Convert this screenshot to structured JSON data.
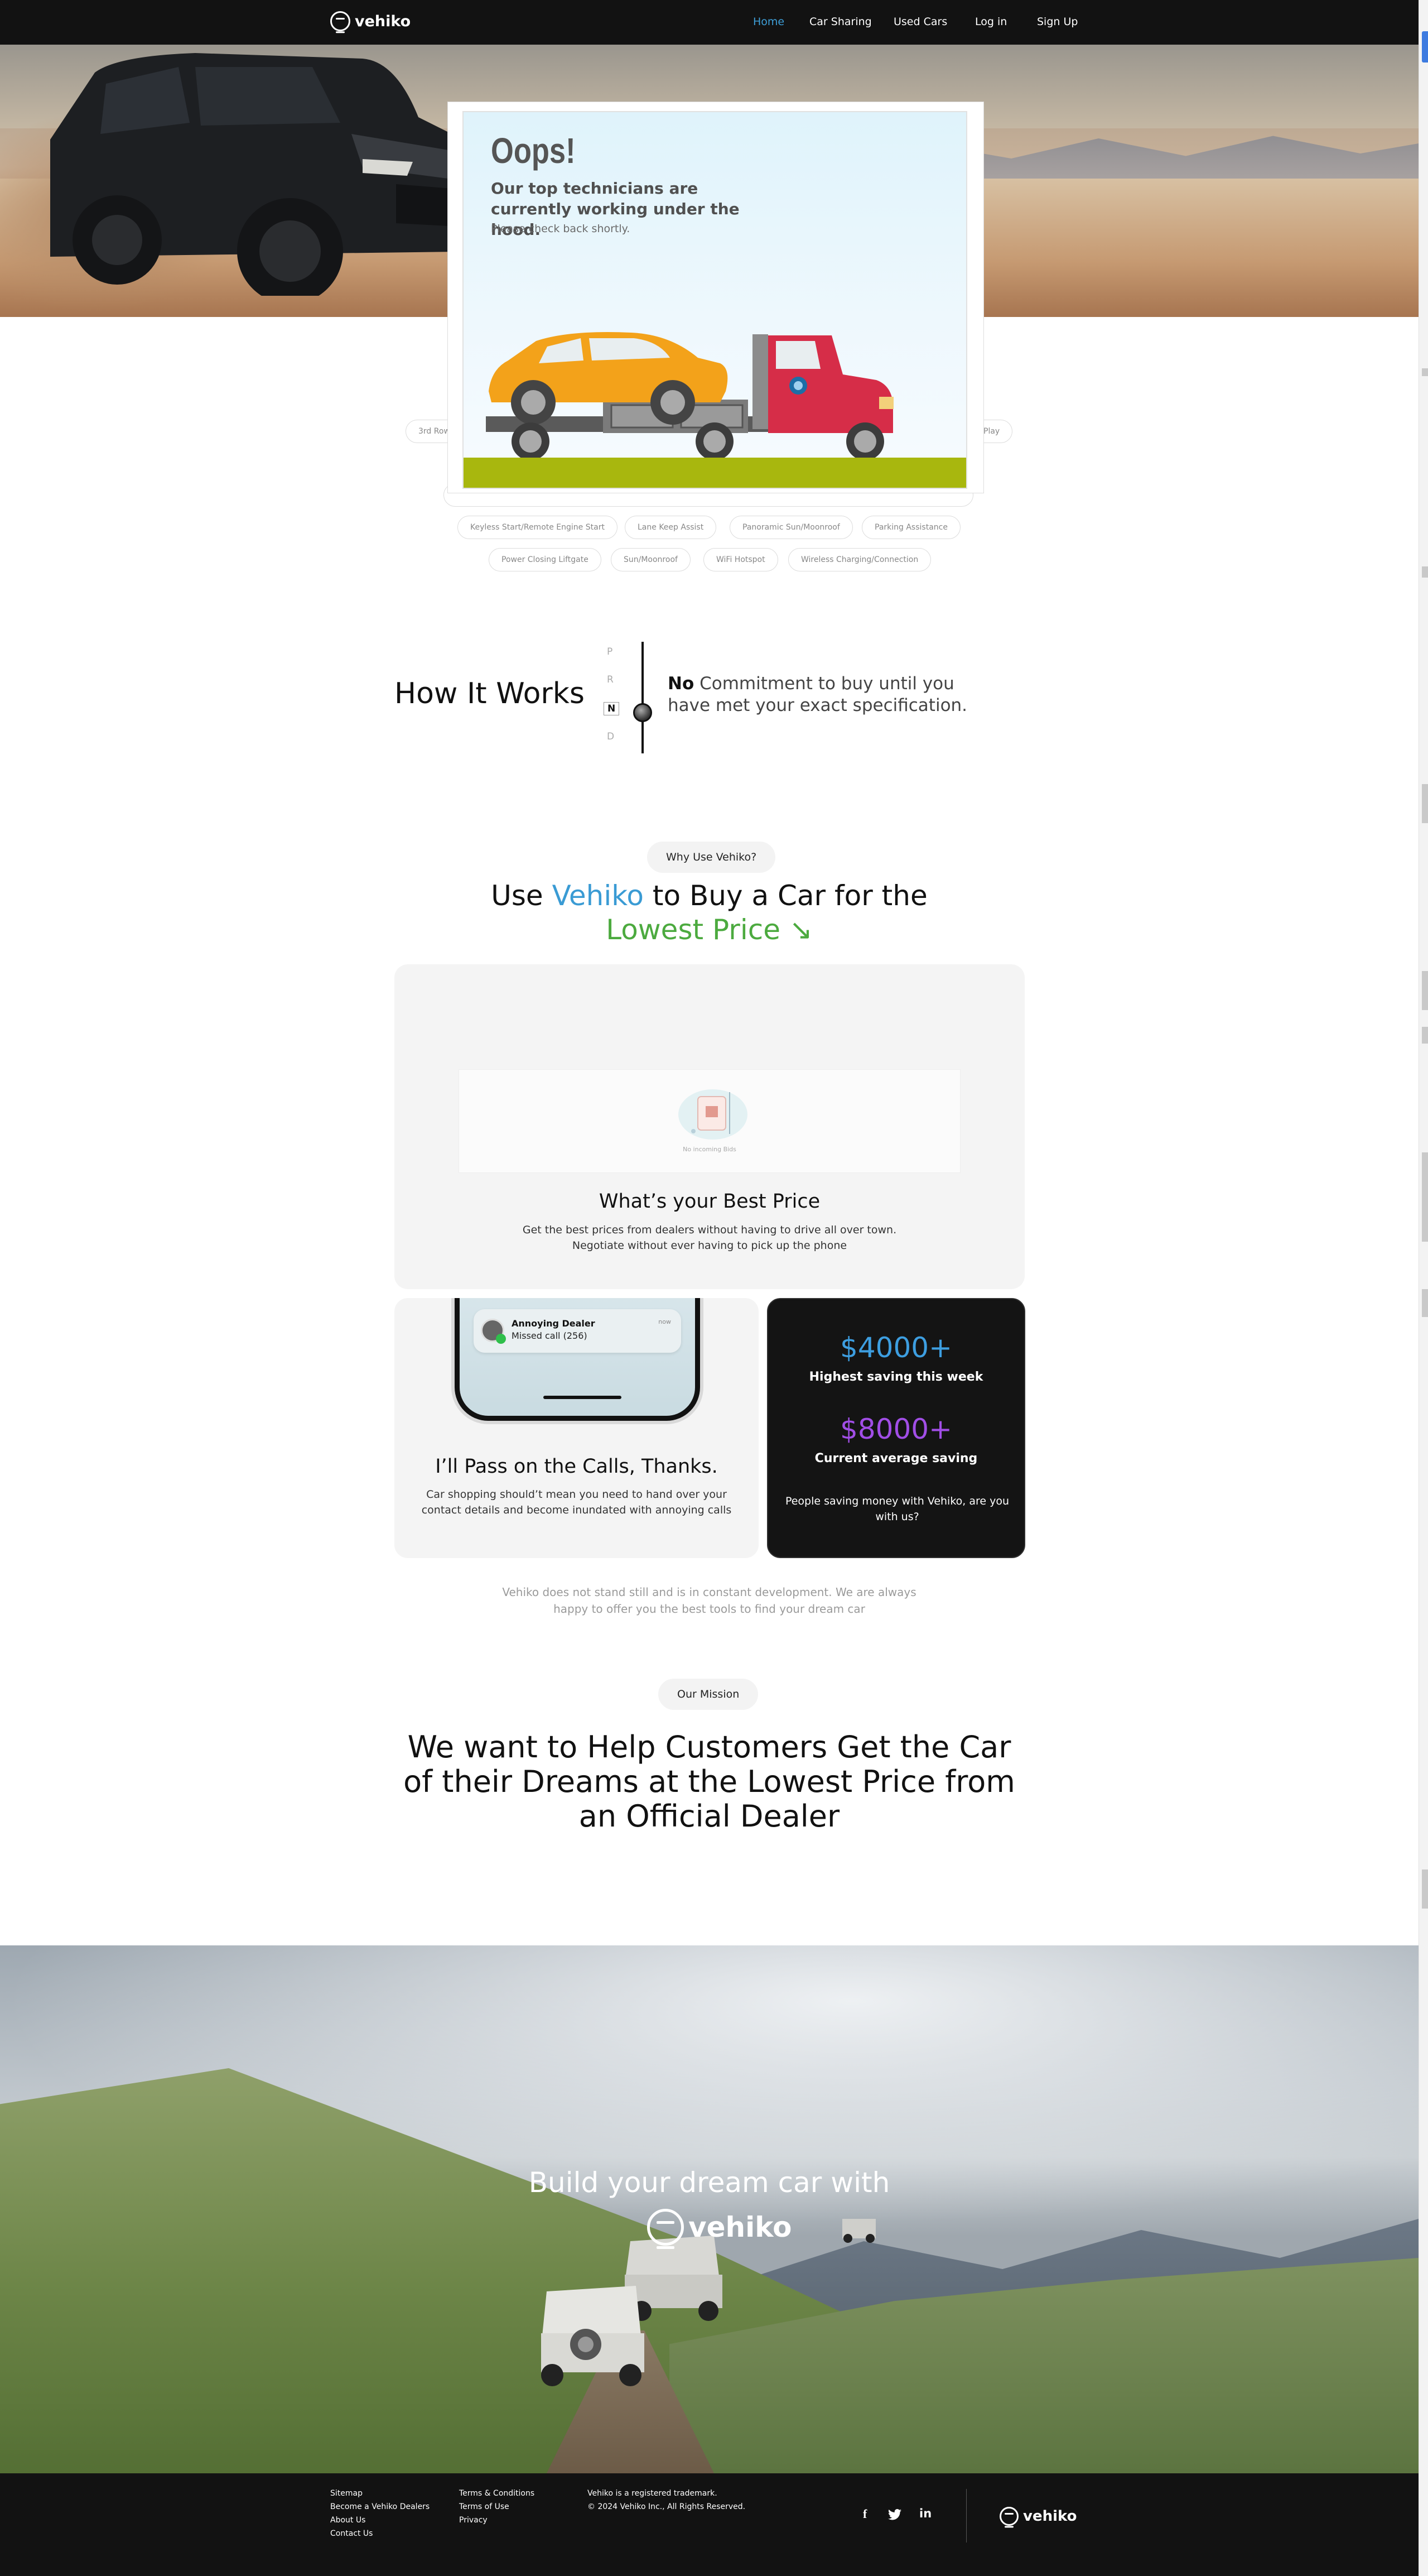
{
  "nav": {
    "brand": "vehiko",
    "items": [
      {
        "label": "Home",
        "active": true
      },
      {
        "label": "Car Sharing"
      },
      {
        "label": "Used Cars"
      },
      {
        "label": "Log in"
      },
      {
        "label": "Sign Up"
      }
    ]
  },
  "modal": {
    "title": "Oops!",
    "subtitle": "Our top technicians are currently working under the hood.",
    "note": "Please check back shortly."
  },
  "features": {
    "chips": [
      "3rd Row",
      "Play",
      "Keyless Start/Remote Engine Start",
      "Lane Keep Assist",
      "Panoramic Sun/Moonroof",
      "Parking Assistance",
      "Power Closing Liftgate",
      "Sun/Moonroof",
      "WiFi Hotspot",
      "Wireless Charging/Connection"
    ]
  },
  "how_it_works": {
    "title": "How It Works",
    "gears": [
      "P",
      "R",
      "N",
      "D"
    ],
    "selected_gear": "N",
    "highlight": "No",
    "text": " Commitment to buy until you have met your exact specification."
  },
  "why": {
    "pill": "Why Use Vehiko?",
    "heading_pre": "Use ",
    "heading_brand": "Vehiko",
    "heading_mid": " to Buy a Car for the",
    "heading_green": "Lowest Price ↘",
    "colors": {
      "brand": "#3a9bd4",
      "green": "#4caa3f"
    }
  },
  "card_best_price": {
    "empty_text": "No incoming Bids",
    "title": "What’s your Best Price",
    "text_line1": "Get the best prices from dealers without having to drive all over town.",
    "text_line2": "Negotiate without ever having to pick up the phone"
  },
  "card_calls": {
    "notif_title": "Annoying Dealer",
    "notif_body": "Missed call (256)",
    "notif_time": "now",
    "title": "I’ll Pass on the Calls, Thanks.",
    "text": "Car shopping should’t mean you need to hand over your contact details and become inundated with annoying calls"
  },
  "card_stats": {
    "stat1_value": "$4000+",
    "stat1_label": "Highest saving this week",
    "stat2_value": "$8000+",
    "stat2_label": "Current average saving",
    "note": "People saving money with Vehiko, are you with us?",
    "colors": {
      "stat1": "#3d9ee0",
      "stat2": "#a14ee6"
    }
  },
  "footnote": "Vehiko does not stand still and is in constant development. We are always happy to offer you the best tools to find your dream car",
  "mission": {
    "pill": "Our Mission",
    "heading": "We want to Help Customers Get the Car of their Dreams at the Lowest Price from an Official Dealer"
  },
  "build": {
    "title": "Build your dream car with",
    "brand": "vehiko"
  },
  "footer": {
    "col1": [
      "Sitemap",
      "Become a Vehiko Dealers",
      "About Us",
      "Contact Us"
    ],
    "col2": [
      "Terms & Conditions",
      "Terms of Use",
      "Privacy"
    ],
    "legal1": "Vehiko is a registered trademark.",
    "legal2": "© 2024 Vehiko Inc., All Rights Reserved.",
    "social": [
      "facebook-icon",
      "twitter-icon",
      "linkedin-icon"
    ],
    "brand": "vehiko"
  }
}
